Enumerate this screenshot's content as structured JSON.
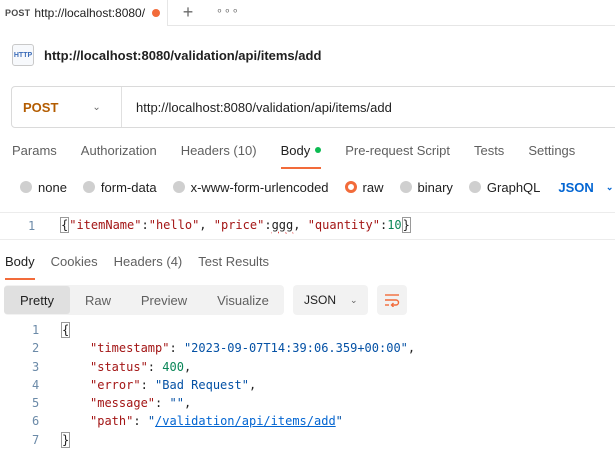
{
  "tab": {
    "method": "POST",
    "title": "http://localhost:8080/",
    "plus": "+",
    "more": "∘∘∘"
  },
  "request": {
    "icon_text": "HTTP",
    "name": "http://localhost:8080/validation/api/items/add",
    "method": "POST",
    "url": "http://localhost:8080/validation/api/items/add"
  },
  "request_tabs": [
    "Params",
    "Authorization",
    "Headers (10)",
    "Body",
    "Pre-request Script",
    "Tests",
    "Settings"
  ],
  "body_types": [
    "none",
    "form-data",
    "x-www-form-urlencoded",
    "raw",
    "binary",
    "GraphQL"
  ],
  "body_format": "JSON",
  "request_body": {
    "line": "1",
    "open": "{",
    "k1": "\"itemName\"",
    "v1": "\"hello\"",
    "k2": "\"price\"",
    "v2": "ggg",
    "k3": "\"quantity\"",
    "v3": "10",
    "close": "}"
  },
  "response_tabs": [
    "Body",
    "Cookies",
    "Headers (4)",
    "Test Results"
  ],
  "view_options": [
    "Pretty",
    "Raw",
    "Preview",
    "Visualize"
  ],
  "response_format": "JSON",
  "response_body": {
    "line_numbers": [
      "1",
      "2",
      "3",
      "4",
      "5",
      "6",
      "7"
    ],
    "open": "{",
    "timestamp_key": "\"timestamp\"",
    "timestamp_val": "\"2023-09-07T14:39:06.359+00:00\"",
    "status_key": "\"status\"",
    "status_val": "400",
    "error_key": "\"error\"",
    "error_val": "\"Bad Request\"",
    "message_key": "\"message\"",
    "message_val": "\"\"",
    "path_key": "\"path\"",
    "path_q1": "\"",
    "path_val": "/validation/api/items/add",
    "path_q2": "\"",
    "close": "}"
  },
  "colors": {
    "accent": "#f26b3a",
    "method": "#b35c00",
    "json_blue": "#0265d2",
    "body_dot": "#0cbb52"
  }
}
